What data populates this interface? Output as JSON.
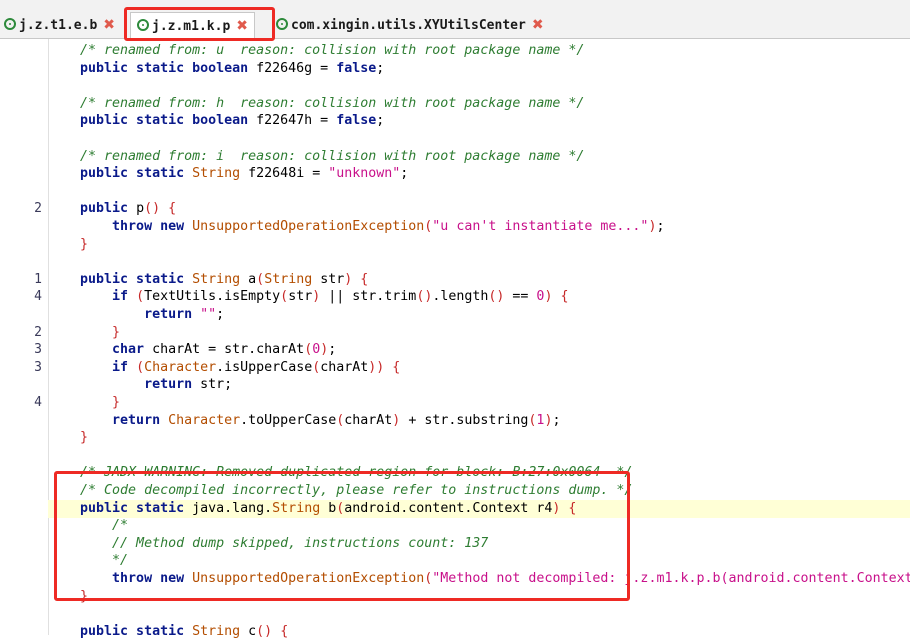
{
  "tabs": [
    {
      "label": "j.z.t1.e.b",
      "active": false
    },
    {
      "label": "j.z.m1.k.p",
      "active": true
    },
    {
      "label": "com.xingin.utils.XYUtilsCenter",
      "active": false
    }
  ],
  "close_glyph": "✖",
  "colors": {
    "accent_red": "#ee2a24",
    "keyword": "#0a1a8a",
    "comment": "#2e7d32",
    "string": "#c8108a",
    "type": "#b34d00"
  },
  "gutter": [
    {
      "line": 9,
      "value": "2"
    },
    {
      "line": 13,
      "value": "1"
    },
    {
      "line": 14,
      "value": "4"
    },
    {
      "line": 16,
      "value": "2"
    },
    {
      "line": 17,
      "value": "3"
    },
    {
      "line": 18,
      "value": "3"
    },
    {
      "line": 20,
      "value": "4"
    }
  ],
  "code": [
    [
      [
        "cm",
        "    /* renamed from: u  reason: collision with root package name */"
      ]
    ],
    [
      [
        "kw",
        "    public static boolean "
      ],
      [
        "id",
        "f22646g = "
      ],
      [
        "kw",
        "false"
      ],
      [
        "id",
        ";"
      ]
    ],
    [],
    [
      [
        "cm",
        "    /* renamed from: h  reason: collision with root package name */"
      ]
    ],
    [
      [
        "kw",
        "    public static boolean "
      ],
      [
        "id",
        "f22647h = "
      ],
      [
        "kw",
        "false"
      ],
      [
        "id",
        ";"
      ]
    ],
    [],
    [
      [
        "cm",
        "    /* renamed from: i  reason: collision with root package name */"
      ]
    ],
    [
      [
        "kw",
        "    public static "
      ],
      [
        "ty",
        "String"
      ],
      [
        "id",
        " f22648i = "
      ],
      [
        "st",
        "\"unknown\""
      ],
      [
        "id",
        ";"
      ]
    ],
    [],
    [
      [
        "kw",
        "    public "
      ],
      [
        "id",
        "p"
      ],
      [
        "pn",
        "() {"
      ]
    ],
    [
      [
        "kw",
        "        throw new "
      ],
      [
        "ty",
        "UnsupportedOperationException"
      ],
      [
        "pn",
        "("
      ],
      [
        "st",
        "\"u can't instantiate me...\""
      ],
      [
        "pn",
        ")"
      ],
      [
        "id",
        ";"
      ]
    ],
    [
      [
        "pn",
        "    }"
      ]
    ],
    [],
    [
      [
        "kw",
        "    public static "
      ],
      [
        "ty",
        "String"
      ],
      [
        "id",
        " a"
      ],
      [
        "pn",
        "("
      ],
      [
        "ty",
        "String"
      ],
      [
        "id",
        " str"
      ],
      [
        "pn",
        ") {"
      ]
    ],
    [
      [
        "kw",
        "        if "
      ],
      [
        "pn",
        "("
      ],
      [
        "id",
        "TextUtils.isEmpty"
      ],
      [
        "pn",
        "("
      ],
      [
        "id",
        "str"
      ],
      [
        "pn",
        ")"
      ],
      [
        "id",
        " || str.trim"
      ],
      [
        "pn",
        "()"
      ],
      [
        "id",
        ".length"
      ],
      [
        "pn",
        "()"
      ],
      [
        "id",
        " == "
      ],
      [
        "nm",
        "0"
      ],
      [
        "pn",
        ") {"
      ]
    ],
    [
      [
        "kw",
        "            return "
      ],
      [
        "st",
        "\"\""
      ],
      [
        "id",
        ";"
      ]
    ],
    [
      [
        "pn",
        "        }"
      ]
    ],
    [
      [
        "kw",
        "        char "
      ],
      [
        "id",
        "charAt = str.charAt"
      ],
      [
        "pn",
        "("
      ],
      [
        "nm",
        "0"
      ],
      [
        "pn",
        ")"
      ],
      [
        "id",
        ";"
      ]
    ],
    [
      [
        "kw",
        "        if "
      ],
      [
        "pn",
        "("
      ],
      [
        "ty",
        "Character"
      ],
      [
        "id",
        ".isUpperCase"
      ],
      [
        "pn",
        "("
      ],
      [
        "id",
        "charAt"
      ],
      [
        "pn",
        ")) {"
      ]
    ],
    [
      [
        "kw",
        "            return "
      ],
      [
        "id",
        "str;"
      ]
    ],
    [
      [
        "pn",
        "        }"
      ]
    ],
    [
      [
        "kw",
        "        return "
      ],
      [
        "ty",
        "Character"
      ],
      [
        "id",
        ".toUpperCase"
      ],
      [
        "pn",
        "("
      ],
      [
        "id",
        "charAt"
      ],
      [
        "pn",
        ")"
      ],
      [
        "id",
        " + str.substring"
      ],
      [
        "pn",
        "("
      ],
      [
        "nm",
        "1"
      ],
      [
        "pn",
        ")"
      ],
      [
        "id",
        ";"
      ]
    ],
    [
      [
        "pn",
        "    }"
      ]
    ],
    [],
    [
      [
        "cm",
        "    /* JADX WARNING: Removed duplicated region for block: B:27:0x0064  */"
      ]
    ],
    [
      [
        "cm",
        "    /* Code decompiled incorrectly, please refer to instructions dump. */"
      ]
    ],
    [
      [
        "kw",
        "    public static "
      ],
      [
        "id",
        "java.lang."
      ],
      [
        "ty",
        "String"
      ],
      [
        "id",
        " b"
      ],
      [
        "pn",
        "("
      ],
      [
        "id",
        "android.content.Context r4"
      ],
      [
        "pn",
        ") {"
      ]
    ],
    [
      [
        "cm",
        "        /*"
      ]
    ],
    [
      [
        "cm",
        "        // Method dump skipped, instructions count: 137"
      ]
    ],
    [
      [
        "cm",
        "        */"
      ]
    ],
    [
      [
        "kw",
        "        throw new "
      ],
      [
        "ty",
        "UnsupportedOperationException"
      ],
      [
        "pn",
        "("
      ],
      [
        "st",
        "\"Method not decompiled: j.z.m1.k.p.b(android.content.Context"
      ]
    ],
    [
      [
        "pn",
        "    }"
      ]
    ],
    [],
    [
      [
        "kw",
        "    public static "
      ],
      [
        "ty",
        "String"
      ],
      [
        "id",
        " c"
      ],
      [
        "pn",
        "() {"
      ]
    ]
  ],
  "highlighted_line": 26
}
